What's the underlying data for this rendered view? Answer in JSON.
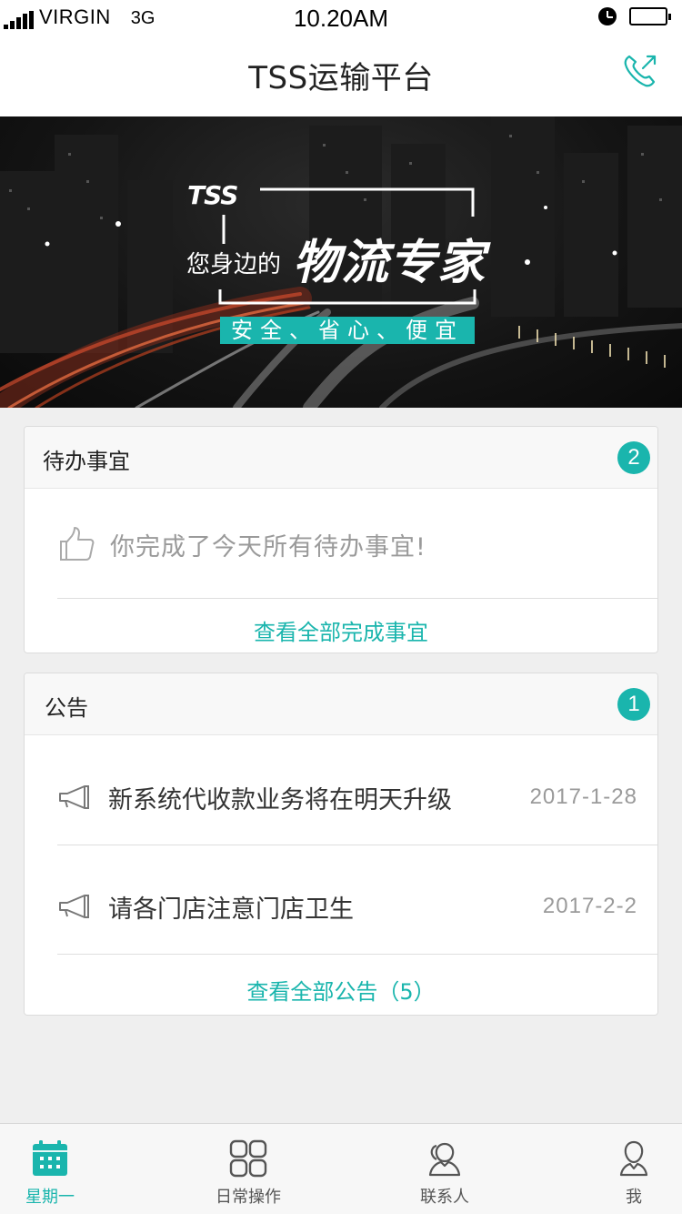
{
  "status_bar": {
    "carrier": "VIRGIN",
    "network": "3G",
    "time": "10.20AM"
  },
  "header": {
    "title": "TSS运输平台",
    "phone_icon": "phone-call-icon"
  },
  "banner": {
    "logo": "TSS",
    "prefix": "您身边的",
    "slogan": "物流专家",
    "tagline": "安全、省心、便宜"
  },
  "todo": {
    "title": "待办事宜",
    "badge": "2",
    "empty_message": "你完成了今天所有待办事宜!",
    "view_all": "查看全部完成事宜",
    "icon": "thumbs-up-icon"
  },
  "notices": {
    "title": "公告",
    "badge": "1",
    "items": [
      {
        "text": "新系统代收款业务将在明天升级",
        "date": "2017-1-28"
      },
      {
        "text": "请各门店注意门店卫生",
        "date": "2017-2-2"
      }
    ],
    "view_all": "查看全部公告（5）",
    "icon": "megaphone-icon"
  },
  "tabbar": {
    "active_color": "#1ab5ad",
    "tabs": [
      {
        "label": "星期一",
        "icon": "calendar-icon",
        "active": true
      },
      {
        "label": "日常操作",
        "icon": "grid-icon",
        "active": false
      },
      {
        "label": "联系人",
        "icon": "contacts-icon",
        "active": false
      },
      {
        "label": "我",
        "icon": "user-icon",
        "active": false
      }
    ]
  },
  "colors": {
    "accent": "#1ab5ad",
    "background": "#efefef"
  }
}
